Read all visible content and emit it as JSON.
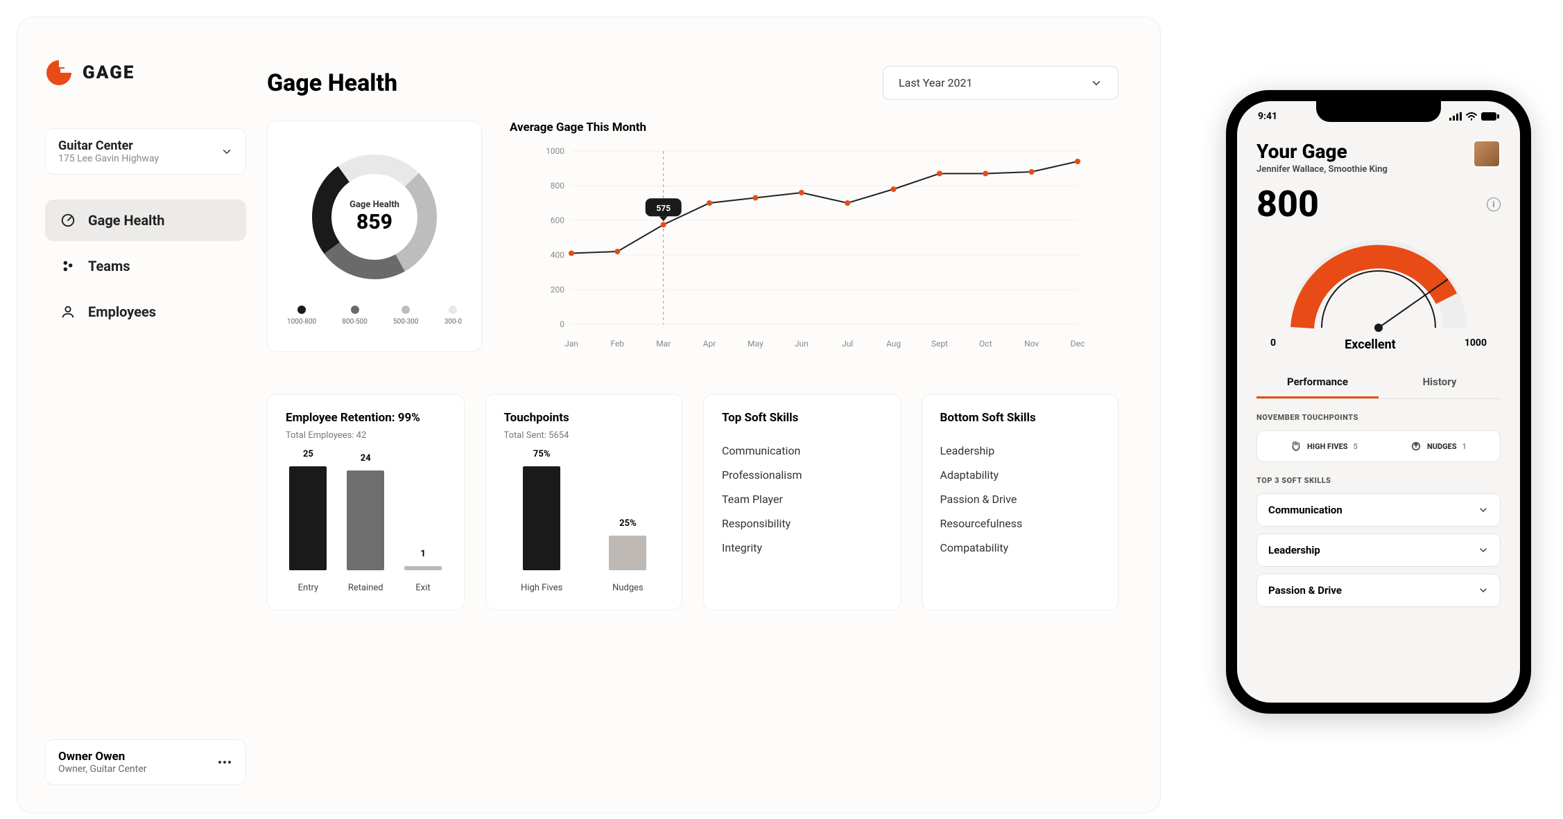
{
  "brand": {
    "name": "GAGE",
    "accent": "#e84b16"
  },
  "org": {
    "name": "Guitar Center",
    "address": "175 Lee Gavin Highway"
  },
  "nav": {
    "items": [
      {
        "id": "health",
        "label": "Gage Health",
        "active": true
      },
      {
        "id": "teams",
        "label": "Teams",
        "active": false
      },
      {
        "id": "employees",
        "label": "Employees",
        "active": false
      }
    ]
  },
  "user": {
    "name": "Owner Owen",
    "role": "Owner,  Guitar Center"
  },
  "header": {
    "title": "Gage Health",
    "period": "Last Year 2021"
  },
  "donut": {
    "label": "Gage Health",
    "value": "859",
    "legend": [
      {
        "range": "1000-800",
        "color": "#1a1a1a"
      },
      {
        "range": "800-500",
        "color": "#6a6a6a"
      },
      {
        "range": "500-300",
        "color": "#bdbdbd"
      },
      {
        "range": "300-0",
        "color": "#e8e8e8"
      }
    ]
  },
  "line": {
    "title": "Average Gage This Month",
    "highlight_month": "Mar",
    "highlight_value": "575"
  },
  "retention": {
    "title": "Employee Retention: 99%",
    "sub": "Total Employees: 42"
  },
  "touchpoints": {
    "title": "Touchpoints",
    "sub": "Total Sent: 5654"
  },
  "topSkills": {
    "title": "Top Soft Skills",
    "items": [
      "Communication",
      "Professionalism",
      "Team Player",
      "Responsibility",
      "Integrity"
    ]
  },
  "bottomSkills": {
    "title": "Bottom Soft Skills",
    "items": [
      "Leadership",
      "Adaptability",
      "Passion & Drive",
      "Resourcefulness",
      "Compatability"
    ]
  },
  "phone": {
    "time": "9:41",
    "title": "Your Gage",
    "subtitle": "Jennifer Wallace, Smoothie King",
    "score": "800",
    "rating": "Excellent",
    "min": "0",
    "max": "1000",
    "tabs": [
      {
        "label": "Performance",
        "active": true
      },
      {
        "label": "History",
        "active": false
      }
    ],
    "touch_title": "NOVEMBER TOUCHPOINTS",
    "touch": [
      {
        "label": "HIGH FIVES",
        "n": "5"
      },
      {
        "label": "NUDGES",
        "n": "1"
      }
    ],
    "softskill_title": "TOP 3 SOFT SKILLS",
    "softskills": [
      "Communication",
      "Leadership",
      "Passion & Drive"
    ]
  },
  "chart_data": [
    {
      "type": "pie",
      "title": "Gage Health",
      "center_value": 859,
      "series": [
        {
          "name": "1000-800",
          "color": "#1a1a1a"
        },
        {
          "name": "800-500",
          "color": "#6a6a6a"
        },
        {
          "name": "500-300",
          "color": "#bdbdbd"
        },
        {
          "name": "300-0",
          "color": "#e8e8e8"
        }
      ]
    },
    {
      "type": "line",
      "title": "Average Gage This Month",
      "xlabel": "",
      "ylabel": "",
      "ylim": [
        0,
        1000
      ],
      "y_ticks": [
        0,
        200,
        400,
        600,
        800,
        1000
      ],
      "categories": [
        "Jan",
        "Feb",
        "Mar",
        "Apr",
        "May",
        "Jun",
        "Jul",
        "Aug",
        "Sept",
        "Oct",
        "Nov",
        "Dec"
      ],
      "values": [
        410,
        420,
        575,
        700,
        730,
        760,
        700,
        780,
        870,
        870,
        880,
        940
      ],
      "highlight": {
        "category": "Mar",
        "value": 575
      }
    },
    {
      "type": "bar",
      "title": "Employee Retention: 99%",
      "subtitle": "Total Employees: 42",
      "categories": [
        "Entry",
        "Retained",
        "Exit"
      ],
      "values": [
        25,
        24,
        1
      ],
      "colors": [
        "#1a1a1a",
        "#6e6e6e",
        "#bfb9b6"
      ]
    },
    {
      "type": "bar",
      "title": "Touchpoints",
      "subtitle": "Total Sent: 5654",
      "categories": [
        "High Fives",
        "Nudges"
      ],
      "values_label": [
        "75%",
        "25%"
      ],
      "values": [
        75,
        25
      ],
      "colors": [
        "#1a1a1a",
        "#bfb9b6"
      ]
    }
  ]
}
